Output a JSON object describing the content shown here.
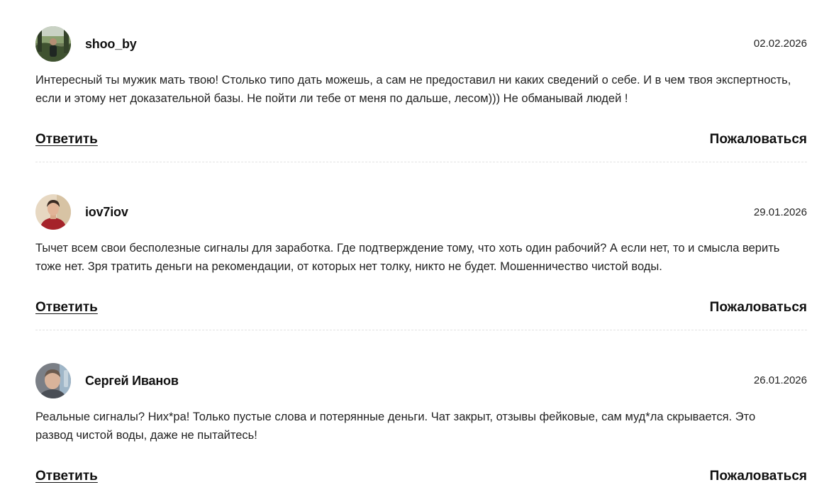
{
  "comments": [
    {
      "author": "shoo_by",
      "date": "02.02.2026",
      "text": "Интересный ты мужик мать твою! Столько типо дать можешь, а сам не предоставил ни каких сведений о себе. И в чем твоя экспертность, если и этому нет доказательной базы. Не пойти ли тебе от меня по дальше, лесом))) Не обманывай людей !",
      "reply_label": "Ответить",
      "report_label": "Пожаловаться"
    },
    {
      "author": "iov7iov",
      "date": "29.01.2026",
      "text": "Тычет всем свои бесполезные сигналы для заработка. Где подтверждение тому, что хоть один рабочий? А если нет, то и смысла верить тоже нет. Зря тратить деньги на рекомендации, от которых нет толку, никто не будет. Мошенничество чистой воды.",
      "reply_label": "Ответить",
      "report_label": "Пожаловаться"
    },
    {
      "author": "Сергей Иванов",
      "date": "26.01.2026",
      "text": "Реальные сигналы? Них*ра! Только пустые слова и потерянные деньги. Чат закрыт, отзывы фейковые, сам муд*ла скрывается. Это развод чистой воды, даже не пытайтесь!",
      "reply_label": "Ответить",
      "report_label": "Пожаловаться"
    }
  ]
}
